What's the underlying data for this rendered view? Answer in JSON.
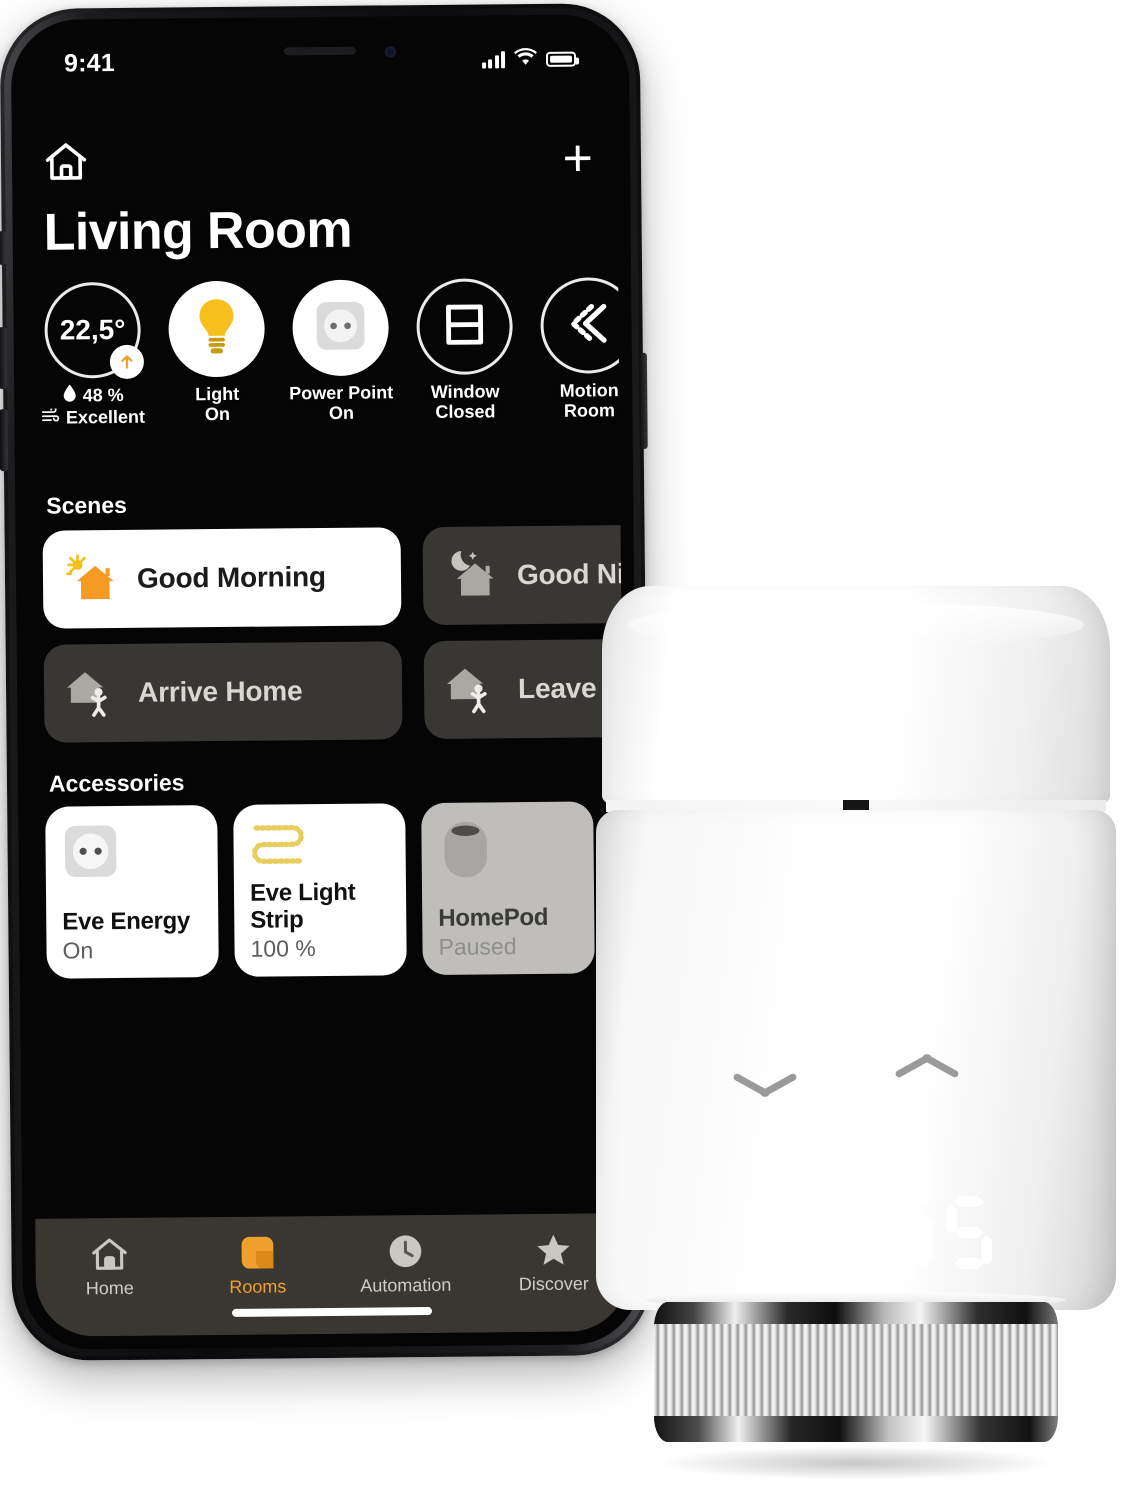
{
  "phone": {
    "status_bar": {
      "time": "9:41",
      "signal_icon": "cellular-bars-icon",
      "wifi_icon": "wifi-icon",
      "battery_icon": "battery-icon"
    },
    "app": {
      "home_icon": "house-icon",
      "add_label": "+",
      "room_title": "Living Room",
      "status_tiles": [
        {
          "name": "climate",
          "temperature": "22,5°",
          "humidity": "48 %",
          "air_quality": "Excellent",
          "trend_icon": "arrow-up-icon",
          "humidity_icon": "droplet-icon",
          "air_icon": "air-wave-icon"
        },
        {
          "name": "light",
          "icon": "lightbulb-icon",
          "label_line1": "Light",
          "label_line2": "On"
        },
        {
          "name": "power-point",
          "icon": "power-socket-icon",
          "label_line1": "Power Point",
          "label_line2": "On"
        },
        {
          "name": "window",
          "icon": "window-icon",
          "label_line1": "Window",
          "label_line2": "Closed"
        },
        {
          "name": "motion",
          "icon": "motion-chevrons-icon",
          "label_line1": "Motion",
          "label_line2": "Room"
        }
      ],
      "scenes_heading": "Scenes",
      "scenes": [
        {
          "label": "Good Morning",
          "icon": "sun-house-icon",
          "state": "on"
        },
        {
          "label": "Good Night",
          "icon": "moon-house-icon",
          "state": "off"
        },
        {
          "label": "Arrive Home",
          "icon": "house-person-arrive-icon",
          "state": "off"
        },
        {
          "label": "Leave Home",
          "icon": "house-person-leave-icon",
          "state": "off"
        }
      ],
      "accessories_heading": "Accessories",
      "accessories": [
        {
          "name": "Eve Energy",
          "status": "On",
          "icon": "power-socket-icon",
          "state": "on"
        },
        {
          "name": "Eve Light Strip",
          "status": "100 %",
          "icon": "light-strip-icon",
          "state": "on"
        },
        {
          "name": "HomePod",
          "status": "Paused",
          "icon": "homepod-icon",
          "state": "dim"
        }
      ],
      "tabs": [
        {
          "label": "Home",
          "icon": "house-icon",
          "active": false
        },
        {
          "label": "Rooms",
          "icon": "rooms-squares-icon",
          "active": true
        },
        {
          "label": "Automation",
          "icon": "clock-icon",
          "active": false
        },
        {
          "label": "Discover",
          "icon": "star-icon",
          "active": false
        }
      ]
    }
  },
  "thermostat": {
    "name": "smart-radiator-thermostat",
    "display_value": "22",
    "display_half": "5",
    "down_button_icon": "chevron-down-icon",
    "up_button_icon": "chevron-up-icon",
    "base_ring": "knurled-metal-collar"
  },
  "colors": {
    "accent_orange": "#F0A02C",
    "bulb_yellow": "#F5C01E",
    "scene_card_dark": "#46433E",
    "tab_bar": "#3E3B36",
    "wall": "#8B8984",
    "floor": "#7D7065"
  }
}
